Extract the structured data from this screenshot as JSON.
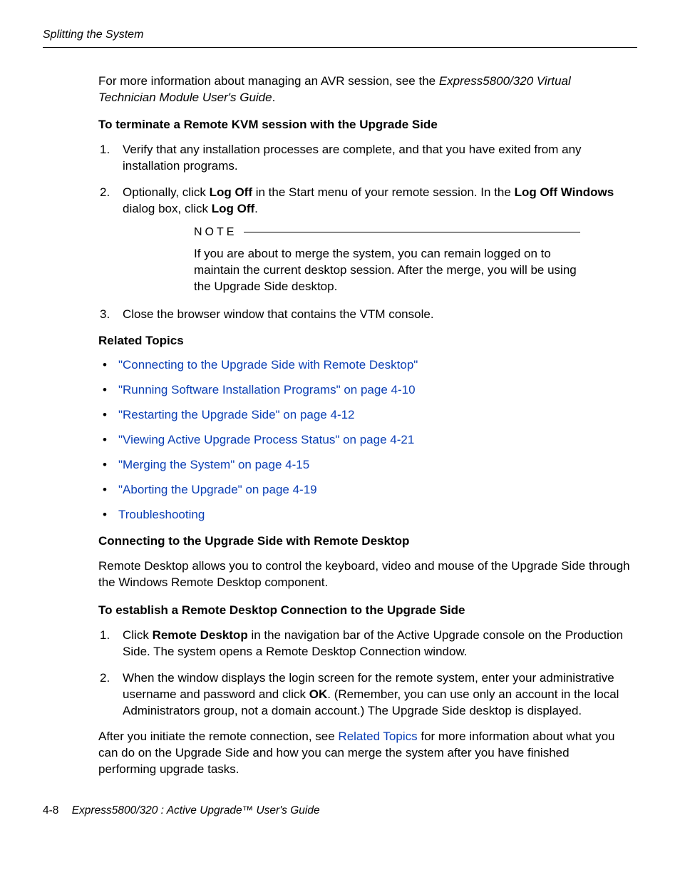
{
  "running_head": "Splitting the System",
  "intro": {
    "prefix": "For more information about managing an AVR session, see the ",
    "doc_title": "Express5800/320 Virtual Technician Module User's Guide",
    "suffix": "."
  },
  "section1_heading": "To terminate a Remote KVM session with the Upgrade Side",
  "steps_a": {
    "s1": {
      "num": "1.",
      "text": "Verify that any installation processes are complete, and that you have exited from any installation programs."
    },
    "s2": {
      "num": "2.",
      "p1": "Optionally, click ",
      "b1": "Log Off",
      "p2": " in the Start menu of your remote session. In the ",
      "b2": "Log Off Windows",
      "p3": " dialog box, click ",
      "b3": "Log Off",
      "p4": "."
    },
    "s3": {
      "num": "3.",
      "text": "Close the browser window that contains the VTM console."
    }
  },
  "note": {
    "label": "NOTE",
    "text": "If you are about to merge the system, you can remain logged on to maintain the current desktop session. After the merge, you will be using the Upgrade Side desktop."
  },
  "related_heading": "Related Topics",
  "related": {
    "r1": "\"Connecting to the Upgrade Side with Remote Desktop\"",
    "r2": "\"Running Software Installation Programs\" on page 4-10",
    "r3": "\"Restarting the Upgrade Side\" on page 4-12",
    "r4": "\"Viewing Active Upgrade Process Status\" on page 4-21",
    "r5": "\"Merging the System\" on page 4-15",
    "r6": "\"Aborting the Upgrade\" on page 4-19",
    "r7": "Troubleshooting"
  },
  "section2_heading": "Connecting to the Upgrade Side with Remote Desktop",
  "section2_intro": "Remote Desktop allows you to control the keyboard, video and mouse of the Upgrade Side through the Windows Remote Desktop component.",
  "section3_heading": "To establish a Remote Desktop Connection to the Upgrade Side",
  "steps_b": {
    "s1": {
      "num": "1.",
      "p1": "Click ",
      "b1": "Remote Desktop",
      "p2": " in the navigation bar of the Active Upgrade console on the Production Side. The system opens a Remote Desktop Connection window."
    },
    "s2": {
      "num": "2.",
      "p1": "When the window displays the login screen for the remote system, enter your administrative username and password and click ",
      "b1": "OK",
      "p2": ". (Remember, you can use only an account in the local Administrators group, not a domain account.) The Upgrade Side desktop is displayed."
    }
  },
  "closing": {
    "p1": "After you initiate the remote connection, see ",
    "link": "Related Topics",
    "p2": " for more information about what you can do on the Upgrade Side and how you can merge the system after you have finished performing upgrade tasks."
  },
  "footer": {
    "page": "4-8",
    "title": "Express5800/320   : Active Upgrade™ User's Guide"
  }
}
